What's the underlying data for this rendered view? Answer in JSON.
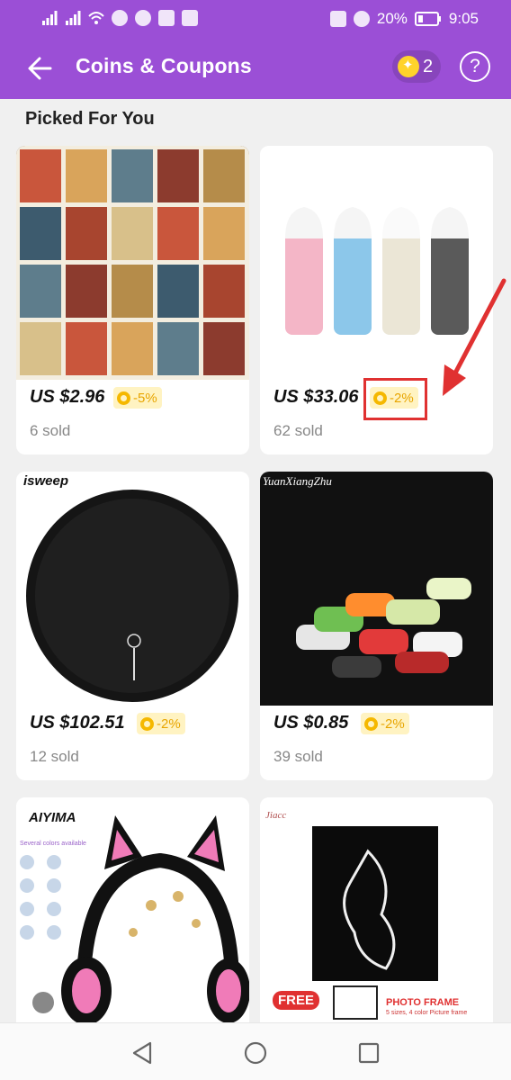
{
  "status_bar": {
    "battery": "20%",
    "time": "9:05"
  },
  "header": {
    "title": "Coins & Coupons",
    "coin_count": "2",
    "help_label": "?"
  },
  "section": {
    "title": "Picked For You"
  },
  "products": [
    {
      "price": "US $2.96",
      "coin_badge": "-5%",
      "sold": "6 sold",
      "image": "vintage-posters"
    },
    {
      "price": "US $33.06",
      "coin_badge": "-2%",
      "sold": "62 sold",
      "image": "water-bottles"
    },
    {
      "brand": "isweep",
      "price": "US $102.51",
      "coin_badge": "-2%",
      "sold": "12 sold",
      "image": "robot-vacuum"
    },
    {
      "brand": "YuanXiangZhu",
      "price": "US $0.85",
      "coin_badge": "-2%",
      "sold": "39 sold",
      "image": "reflective-bands"
    },
    {
      "brand": "AIYIMA",
      "caption": "Several colors available",
      "image": "cat-ear-headphones"
    },
    {
      "brand": "Jiacc",
      "promo": "FREE",
      "frame_title": "PHOTO FRAME",
      "frame_sub": "5 sizes, 4 color Picture frame",
      "image": "photo-frame-art"
    }
  ],
  "colors": {
    "brand": "#9b4fd6",
    "coin": "#f5b800",
    "highlight": "#e03131"
  }
}
